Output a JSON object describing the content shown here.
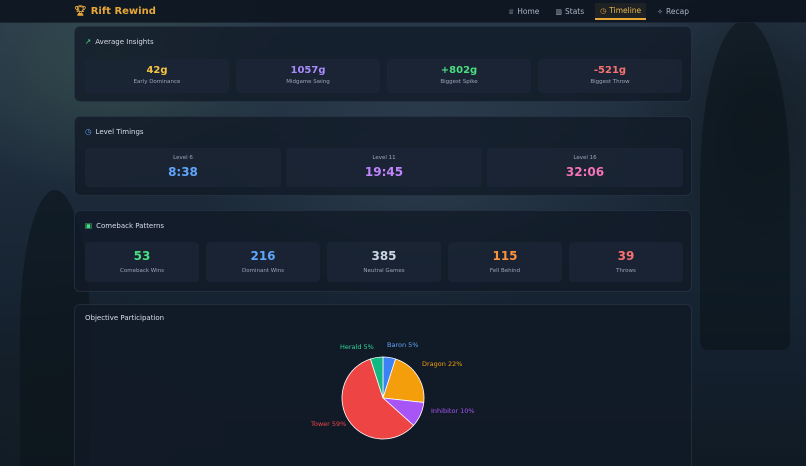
{
  "app": {
    "title": "Rift Rewind"
  },
  "nav": [
    {
      "label": "Home",
      "icon": "trophy-icon",
      "active": false
    },
    {
      "label": "Stats",
      "icon": "bar-chart-icon",
      "active": false
    },
    {
      "label": "Timeline",
      "icon": "clock-icon",
      "active": true
    },
    {
      "label": "Recap",
      "icon": "sparkle-icon",
      "active": false
    }
  ],
  "insights": {
    "title": "Average Insights",
    "items": [
      {
        "value": "42g",
        "label": "Early Dominance",
        "color": "#f5c542"
      },
      {
        "value": "1057g",
        "label": "Midgame Swing",
        "color": "#a78bfa"
      },
      {
        "value": "+802g",
        "label": "Biggest Spike",
        "color": "#4ade80"
      },
      {
        "value": "-521g",
        "label": "Biggest Throw",
        "color": "#f87171"
      }
    ]
  },
  "levels": {
    "title": "Level Timings",
    "items": [
      {
        "label": "Level 6",
        "value": "8:38",
        "color": "#60a5fa"
      },
      {
        "label": "Level 11",
        "value": "19:45",
        "color": "#c084fc"
      },
      {
        "label": "Level 16",
        "value": "32:06",
        "color": "#f472b6"
      }
    ]
  },
  "comeback": {
    "title": "Comeback Patterns",
    "items": [
      {
        "value": "53",
        "label": "Comeback Wins",
        "color": "#4ade80"
      },
      {
        "value": "216",
        "label": "Dominant Wins",
        "color": "#60a5fa"
      },
      {
        "value": "385",
        "label": "Neutral Games",
        "color": "#cbd5e1"
      },
      {
        "value": "115",
        "label": "Fell Behind",
        "color": "#fb923c"
      },
      {
        "value": "39",
        "label": "Throws",
        "color": "#f87171"
      }
    ]
  },
  "objectives": {
    "title": "Objective Participation",
    "chart_data": {
      "type": "pie",
      "slices": [
        {
          "label": "Baron 5%",
          "value": 5,
          "color": "#3b82f6"
        },
        {
          "label": "Dragon 22%",
          "value": 22,
          "color": "#f59e0b"
        },
        {
          "label": "Inhibitor 10%",
          "value": 10,
          "color": "#a855f7"
        },
        {
          "label": "Tower 59%",
          "value": 59,
          "color": "#ef4444"
        },
        {
          "label": "Herald 5%",
          "value": 5,
          "color": "#10b981"
        }
      ]
    }
  }
}
